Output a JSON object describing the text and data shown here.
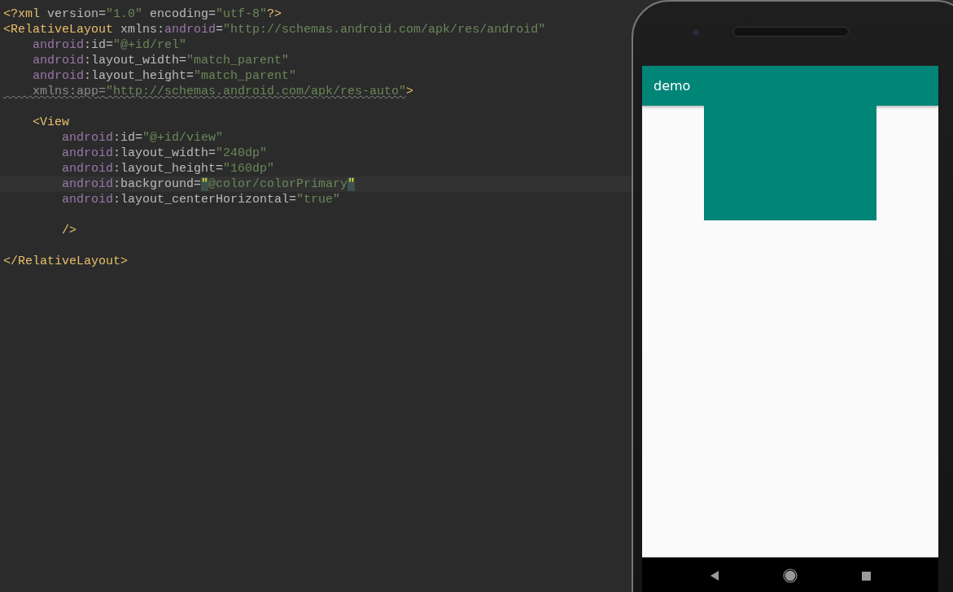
{
  "editor": {
    "lines": [
      {
        "kind": "code",
        "current": false,
        "tokens": [
          {
            "kind": "tag",
            "text": "<?xml"
          },
          {
            "kind": "attr",
            "text": " version"
          },
          {
            "kind": "punct",
            "text": "="
          },
          {
            "kind": "string",
            "text": "\"1.0\""
          },
          {
            "kind": "attr",
            "text": " encoding"
          },
          {
            "kind": "punct",
            "text": "="
          },
          {
            "kind": "string",
            "text": "\"utf-8\""
          },
          {
            "kind": "tag",
            "text": "?>"
          }
        ]
      },
      {
        "kind": "code",
        "current": false,
        "tokens": [
          {
            "kind": "tag",
            "text": "<RelativeLayout"
          },
          {
            "kind": "attr",
            "text": " xmlns:"
          },
          {
            "kind": "ns",
            "text": "android"
          },
          {
            "kind": "punct",
            "text": "="
          },
          {
            "kind": "string",
            "text": "\"http://schemas.android.com/apk/res/android\""
          }
        ]
      },
      {
        "kind": "code",
        "current": false,
        "tokens": [
          {
            "kind": "ns",
            "text": "    android"
          },
          {
            "kind": "attr",
            "text": ":id"
          },
          {
            "kind": "punct",
            "text": "="
          },
          {
            "kind": "string",
            "text": "\"@+id/rel\""
          }
        ]
      },
      {
        "kind": "code",
        "current": false,
        "tokens": [
          {
            "kind": "ns",
            "text": "    android"
          },
          {
            "kind": "attr",
            "text": ":layout_width"
          },
          {
            "kind": "punct",
            "text": "="
          },
          {
            "kind": "string",
            "text": "\"match_parent\""
          }
        ]
      },
      {
        "kind": "code",
        "current": false,
        "tokens": [
          {
            "kind": "ns",
            "text": "    android"
          },
          {
            "kind": "attr",
            "text": ":layout_height"
          },
          {
            "kind": "punct",
            "text": "="
          },
          {
            "kind": "string",
            "text": "\"match_parent\""
          }
        ]
      },
      {
        "kind": "code",
        "current": false,
        "tokens": [
          {
            "kind": "warn-attr",
            "text": "    xmlns:app"
          },
          {
            "kind": "warn-punct",
            "text": "="
          },
          {
            "kind": "warn-string",
            "text": "\"http://schemas.android.com/apk/res-auto\""
          },
          {
            "kind": "tag",
            "text": ">"
          }
        ]
      },
      {
        "kind": "blank",
        "current": false
      },
      {
        "kind": "code",
        "current": false,
        "tokens": [
          {
            "kind": "tag",
            "text": "    <View"
          }
        ]
      },
      {
        "kind": "code",
        "current": false,
        "tokens": [
          {
            "kind": "ns",
            "text": "        android"
          },
          {
            "kind": "attr",
            "text": ":id"
          },
          {
            "kind": "punct",
            "text": "="
          },
          {
            "kind": "string",
            "text": "\"@+id/view\""
          }
        ]
      },
      {
        "kind": "code",
        "current": false,
        "tokens": [
          {
            "kind": "ns",
            "text": "        android"
          },
          {
            "kind": "attr",
            "text": ":layout_width"
          },
          {
            "kind": "punct",
            "text": "="
          },
          {
            "kind": "string",
            "text": "\"240dp\""
          }
        ]
      },
      {
        "kind": "code",
        "current": false,
        "tokens": [
          {
            "kind": "ns",
            "text": "        android"
          },
          {
            "kind": "attr",
            "text": ":layout_height"
          },
          {
            "kind": "punct",
            "text": "="
          },
          {
            "kind": "string",
            "text": "\"160dp\""
          }
        ]
      },
      {
        "kind": "code",
        "current": true,
        "tokens": [
          {
            "kind": "ns",
            "text": "        android"
          },
          {
            "kind": "attr",
            "text": ":background"
          },
          {
            "kind": "punct",
            "text": "="
          },
          {
            "kind": "match",
            "text": "\""
          },
          {
            "kind": "string",
            "text": "@color/colorPrimary"
          },
          {
            "kind": "match",
            "text": "\""
          }
        ]
      },
      {
        "kind": "code",
        "current": false,
        "tokens": [
          {
            "kind": "ns",
            "text": "        android"
          },
          {
            "kind": "attr",
            "text": ":layout_centerHorizontal"
          },
          {
            "kind": "punct",
            "text": "="
          },
          {
            "kind": "string",
            "text": "\"true\""
          }
        ]
      },
      {
        "kind": "blank",
        "current": false
      },
      {
        "kind": "code",
        "current": false,
        "tokens": [
          {
            "kind": "tag",
            "text": "        />"
          }
        ]
      },
      {
        "kind": "blank",
        "current": false
      },
      {
        "kind": "code",
        "current": false,
        "tokens": [
          {
            "kind": "tag",
            "text": "</RelativeLayout>"
          }
        ]
      }
    ]
  },
  "preview": {
    "app_bar": {
      "title": "demo"
    }
  }
}
